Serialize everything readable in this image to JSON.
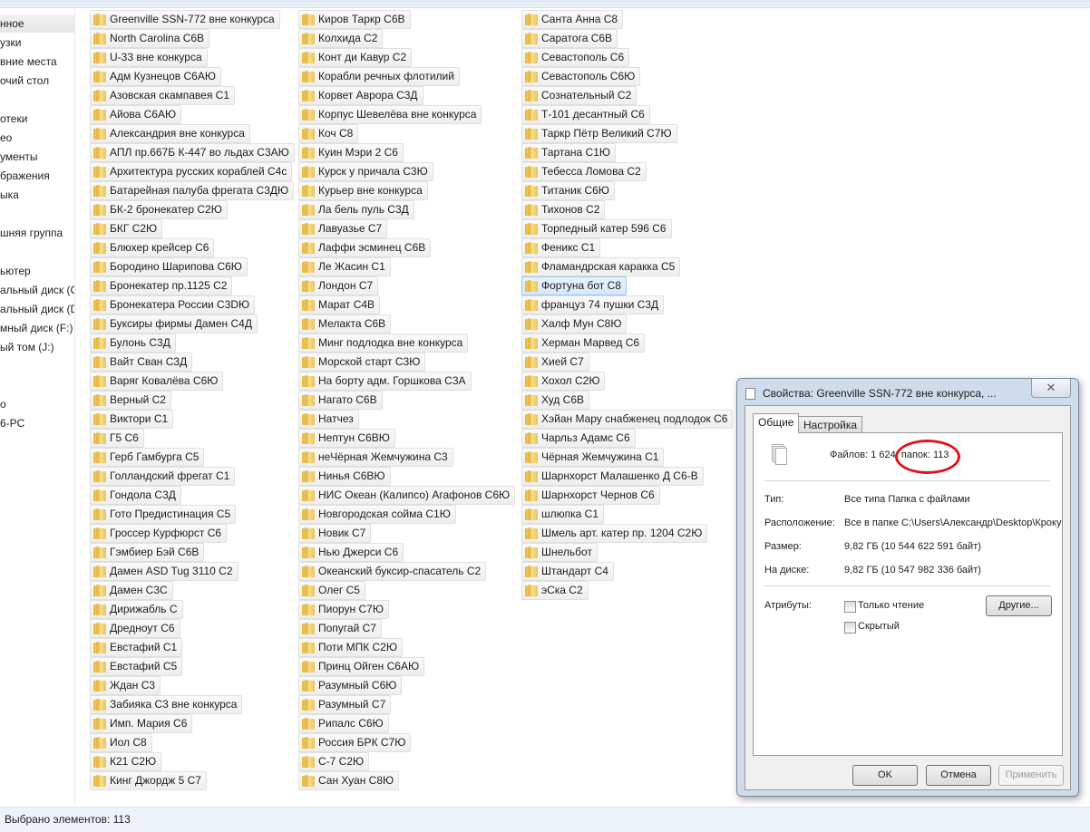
{
  "sidebar": {
    "items": [
      {
        "label": "нное",
        "selected": true
      },
      {
        "label": "узки"
      },
      {
        "label": "вние места"
      },
      {
        "label": "очий стол"
      },
      {
        "label": ""
      },
      {
        "label": "отеки"
      },
      {
        "label": "ео"
      },
      {
        "label": "ументы"
      },
      {
        "label": "бражения"
      },
      {
        "label": "ыка"
      },
      {
        "label": ""
      },
      {
        "label": "шняя группа"
      },
      {
        "label": ""
      },
      {
        "label": "ьютер"
      },
      {
        "label": "альный диск (C"
      },
      {
        "label": "альный диск (D"
      },
      {
        "label": "мный диск (F:)"
      },
      {
        "label": "ый том (J:)"
      },
      {
        "label": ""
      },
      {
        "label": ""
      },
      {
        "label": "о"
      },
      {
        "label": "6-PC"
      }
    ]
  },
  "folder_icon": "folder-icon",
  "columns": [
    [
      "Greenville SSN-772 вне конкурса",
      "North Carolina С6В",
      "U-33 вне конкурса",
      "Адм Кузнецов С6АЮ",
      "Азовская скампавея С1",
      "Айова С6АЮ",
      "Александрия вне конкурса",
      "АПЛ пр.667Б К-447 во льдах С3АЮ",
      "Архитектура русских кораблей С4с",
      "Батарейная палуба фрегата С3ДЮ",
      "БК-2 бронекатер С2Ю",
      "БКГ С2Ю",
      "Блюхер крейсер С6",
      "Бородино Шарипова С6Ю",
      "Бронекатер пр.1125 С2",
      "Бронекатера России С3DЮ",
      "Буксиры фирмы Дамен С4Д",
      "Булонь С3Д",
      "Вайт Сван С3Д",
      "Варяг Ковалёва С6Ю",
      "Верный С2",
      "Виктори С1",
      "Г5 С6",
      "Герб Гамбурга С5",
      "Голландский фрегат С1",
      "Гондола С3Д",
      "Гото Предистинация С5",
      "Гроссер Курфюрст С6",
      "Гэмбиер Бэй С6В",
      "Дамен ASD Tug 3110 С2",
      "Дамен С3С",
      "Дирижабль С",
      "Дредноут С6",
      "Евстафий С1",
      "Евстафий С5",
      "Ждан С3",
      "Забияка С3 вне конкурса",
      "Имп. Мария С6",
      "Иол С8",
      "К21 С2Ю",
      "Кинг Джордж 5 С7"
    ],
    [
      "Киров Таркр С6В",
      "Колхида С2",
      "Конт ди Кавур С2",
      "Корабли речных флотилий",
      "Корвет Аврора С3Д",
      "Корпус Шевелёва вне конкурса",
      "Коч С8",
      "Куин Мэри 2 С6",
      "Курск у причала С3Ю",
      "Курьер вне конкурса",
      "Ла бель пуль С3Д",
      "Лавуазье С7",
      "Лаффи эсминец С6В",
      "Ле Жасин С1",
      "Лондон С7",
      "Марат С4В",
      "Мелакта С6В",
      "Минг подлодка вне конкурса",
      "Морской старт С3Ю",
      "На борту адм. Горшкова С3А",
      "Нагато С6В",
      "Натчез",
      "Нептун С6ВЮ",
      "неЧёрная Жемчужина С3",
      "Нинья С6ВЮ",
      "НИС Океан (Калипсо) Агафонов С6Ю",
      "Новгородская сойма С1Ю",
      "Новик С7",
      "Нью Джерси С6",
      "Океанский буксир-спасатель С2",
      "Олег С5",
      "Пиорун С7Ю",
      "Попугай С7",
      "Поти МПК С2Ю",
      "Принц Ойген С6АЮ",
      "Разумный С6Ю",
      "Разумный С7",
      "Рипалс С6Ю",
      "Россия БРК С7Ю",
      "С-7 С2Ю",
      "Сан Хуан С8Ю"
    ],
    [
      "Санта Анна С8",
      "Саратога С6В",
      "Севастополь С6",
      "Севастополь С6Ю",
      "Сознательный С2",
      "Т-101 десантный С6",
      "Таркр Пётр Великий С7Ю",
      "Тартана С1Ю",
      "Тебесса Ломова С2",
      "Титаник С6Ю",
      "Тихонов С2",
      "Торпедный катер 596 С6",
      "Феникс С1",
      "Фламандрская каракка С5",
      "Фортуна бот С8",
      "француз 74 пушки С3Д",
      "Халф Мун С8Ю",
      "Херман Марвед С6",
      "Хией С7",
      "Хохол С2Ю",
      "Худ С6В",
      "Хэйан Мару снабженец подлодок С6",
      "Чарльз Адамс С6",
      "Чёрная Жемчужина С1",
      "Шарнхорст Малашенко Д С6-В",
      "Шарнхорст Чернов С6",
      "шлюпка С1",
      "Шмель арт. катер пр. 1204  С2Ю",
      "Шнельбот",
      "Штандарт С4",
      "эСка С2"
    ]
  ],
  "highlighted_item": "Фортуна бот С8",
  "status": {
    "text": "Выбрано элементов: 113"
  },
  "dialog": {
    "title": "Свойства: Greenville SSN-772 вне конкурса, ...",
    "close": "✕",
    "tabs": [
      "Общие",
      "Настройка"
    ],
    "counts": "Файлов: 1 624, папок: 113",
    "type_label": "Тип:",
    "type_value": "Все типа Папка с файлами",
    "location_label": "Расположение:",
    "location_value": "Все в папке C:\\Users\\Александр\\Desktop\\Кроку",
    "size_label": "Размер:",
    "size_value": "9,82 ГБ (10 544 622 591 байт)",
    "disk_label": "На диске:",
    "disk_value": "9,82 ГБ (10 547 982 336 байт)",
    "attributes_label": "Атрибуты:",
    "readonly_label": "Только чтение",
    "readonly_checked": false,
    "hidden_label": "Скрытый",
    "hidden_checked": false,
    "other_button": "Другие...",
    "ok_button": "OK",
    "cancel_button": "Отмена",
    "apply_button": "Применить",
    "annotation_color": "#e0141e"
  }
}
